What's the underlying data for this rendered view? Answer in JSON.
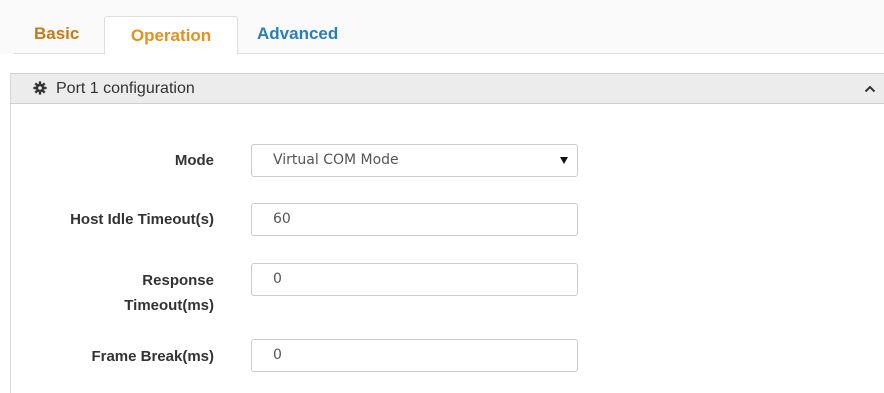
{
  "tabs": [
    {
      "label": "Basic",
      "active": false
    },
    {
      "label": "Operation",
      "active": true
    },
    {
      "label": "Advanced",
      "active": false
    }
  ],
  "panel": {
    "title": "Port 1 configuration",
    "icon": "gear-icon",
    "collapse_icon": "chevron-up-icon"
  },
  "form": {
    "mode": {
      "label": "Mode",
      "value": "Virtual COM Mode"
    },
    "host_idle_timeout": {
      "label": "Host Idle Timeout(s)",
      "value": "60"
    },
    "response_timeout": {
      "label_line1": "Response",
      "label_line2": "Timeout(ms)",
      "value": "0"
    },
    "frame_break": {
      "label": "Frame Break(ms)",
      "value": "0"
    }
  },
  "colors": {
    "tab_basic": "#c87a14",
    "tab_operation": "#e8901c",
    "tab_advanced": "#2a7fb8",
    "panel_header_bg": "#ececec"
  }
}
